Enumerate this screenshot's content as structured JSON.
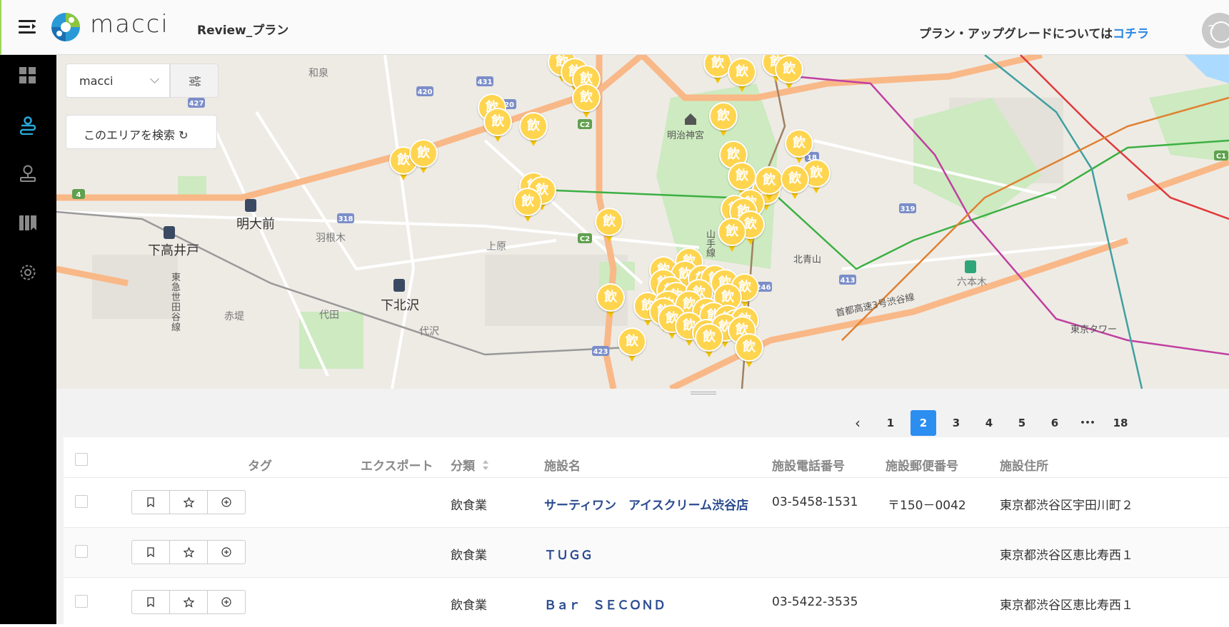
{
  "header": {
    "app_name": "macci",
    "plan_name": "Review_プラン",
    "upgrade_text": "プラン・アップグレードについては",
    "upgrade_link": "コチラ",
    "help_icon": "question-icon"
  },
  "sidebar": {
    "items": [
      {
        "name": "dashboard-icon",
        "active": false
      },
      {
        "name": "map-pin-icon",
        "active": true
      },
      {
        "name": "user-pin-icon",
        "active": false
      },
      {
        "name": "book-icon",
        "active": false
      },
      {
        "name": "gear-icon",
        "active": false
      }
    ],
    "active_color": "#29a9d8"
  },
  "map_controls": {
    "select_value": "macci",
    "search_area_label": "このエリアを検索 ↻"
  },
  "map": {
    "pin_label": "飲",
    "labels": {
      "wasen": "和泉",
      "meidaimae": "明大前",
      "shimotakaido": "下高井戸",
      "hanegi": "羽根木",
      "uehara": "上原",
      "shimokitazawa": "下北沢",
      "akatsutsumi": "赤堤",
      "daita": "代田",
      "daizawa": "代沢",
      "meiji_jingu": "明治神宮",
      "yamanote": "山手線",
      "kita_aoyama": "北青山",
      "roppongi": "六本木",
      "tokyo_tower": "東京タワー",
      "expressway": "首都高速3号渋谷線",
      "setagaya_line": "東急世田谷線"
    },
    "route_numbers": [
      "427",
      "420",
      "431",
      "20",
      "C2",
      "C2",
      "4",
      "318",
      "423",
      "246",
      "413",
      "319",
      "C1",
      "18"
    ]
  },
  "pagination": {
    "prev": "‹",
    "pages": [
      "1",
      "2",
      "3",
      "4",
      "5",
      "6",
      "•••",
      "18"
    ],
    "active": "2"
  },
  "table": {
    "columns": [
      "タグ",
      "エクスポート",
      "分類",
      "施設名",
      "施設電話番号",
      "施設郵便番号",
      "施設住所"
    ],
    "rows": [
      {
        "category": "飲食業",
        "name": "サーティワン　アイスクリーム渋谷店",
        "phone": "03-5458-1531",
        "postal": "〒150－0042",
        "address": "東京都渋谷区宇田川町２"
      },
      {
        "category": "飲食業",
        "name": "ＴＵＧＧ",
        "phone": "",
        "postal": "",
        "address": "東京都渋谷区恵比寿西１"
      },
      {
        "category": "飲食業",
        "name": "Ｂａｒ　ＳＥＣＯＮＤ",
        "phone": "03-5422-3535",
        "postal": "",
        "address": "東京都渋谷区恵比寿西１"
      }
    ],
    "row_actions": [
      "bookmark-icon",
      "star-icon",
      "plus-circle-icon"
    ]
  }
}
